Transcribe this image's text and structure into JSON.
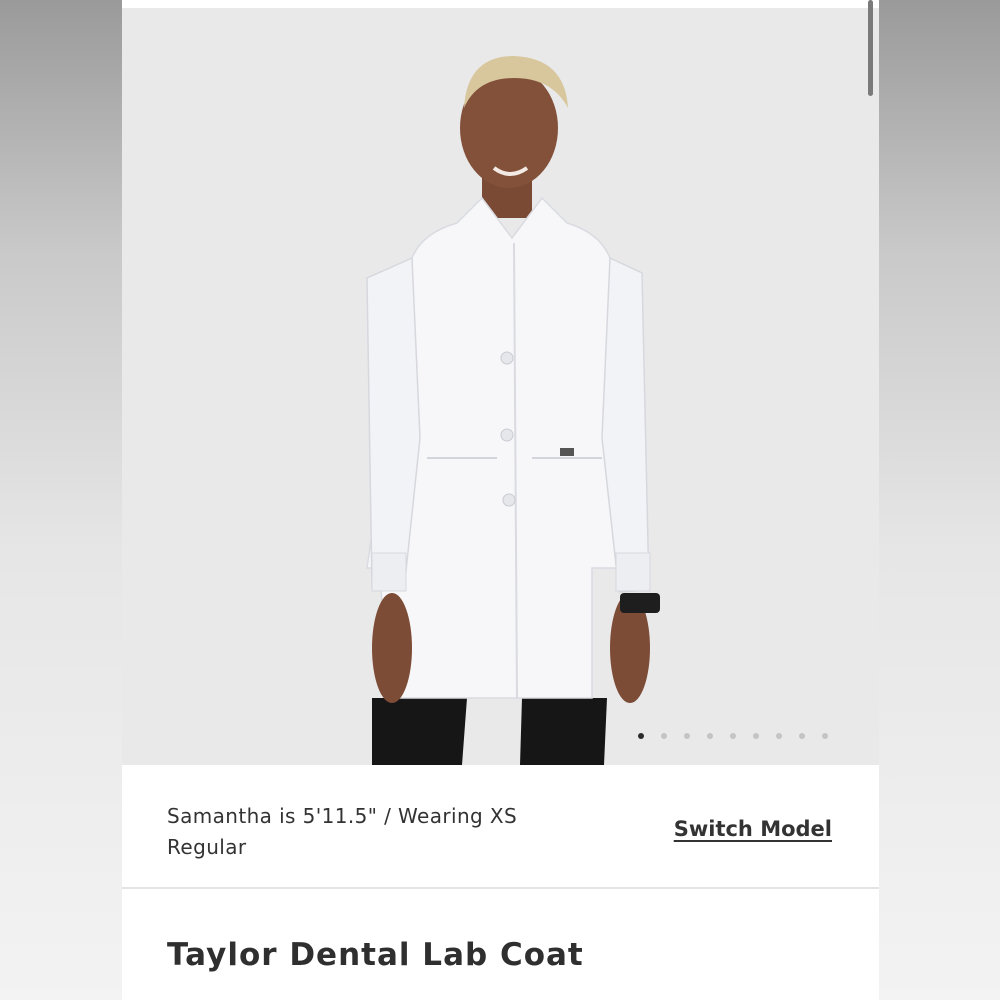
{
  "product_image": {
    "description_icon": "model-photo",
    "carousel_total": 9,
    "carousel_active_index": 0
  },
  "model": {
    "info": "Samantha is 5'11.5\" / Wearing XS Regular",
    "switch_label": "Switch Model"
  },
  "product": {
    "title": "Taylor Dental Lab Coat"
  },
  "colors": {
    "text": "#333333",
    "active_dot": "#2b2b2b",
    "inactive_dot": "#c4c4c4",
    "coat": "#f7f7f9"
  }
}
